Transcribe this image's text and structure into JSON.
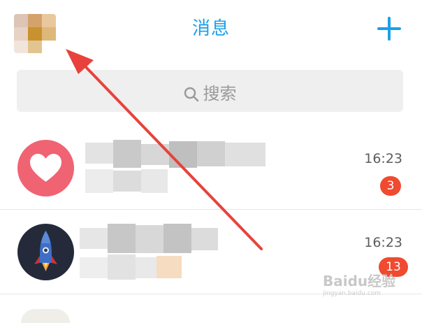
{
  "header": {
    "title": "消息",
    "add_icon": "plus-icon"
  },
  "search": {
    "placeholder": "搜索",
    "icon": "search-icon"
  },
  "conversations": [
    {
      "avatar_icon": "heart-icon",
      "time": "16:23",
      "unread": "3"
    },
    {
      "avatar_icon": "rocket-icon",
      "time": "16:23",
      "unread": "13"
    }
  ],
  "colors": {
    "accent": "#1aa0e8",
    "badge": "#f04a30",
    "annotation_arrow": "#e8423c"
  },
  "watermark": {
    "logo": "Baidu经验",
    "url": "jingyan.baidu.com"
  }
}
